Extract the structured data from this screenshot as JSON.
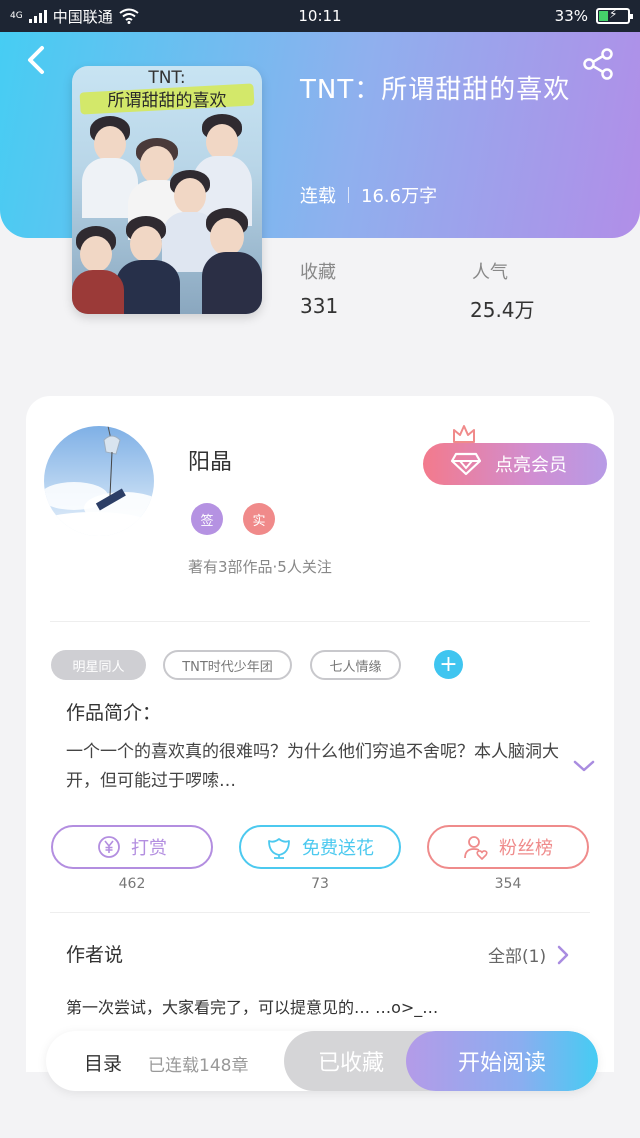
{
  "status_bar": {
    "network": "4G",
    "carrier": "中国联通",
    "time": "10:11",
    "battery": "33%",
    "battery_level": 0.33
  },
  "book": {
    "cover_title_top": "TNT:",
    "cover_title_bottom": "所谓甜甜的喜欢",
    "title": "TNT：所谓甜甜的喜欢",
    "status": "连载",
    "word_count": "16.6万字",
    "favorites_label": "收藏",
    "favorites_value": "331",
    "popularity_label": "人气",
    "popularity_value": "25.4万"
  },
  "author": {
    "name": "阳晶",
    "badge_sign": "签",
    "badge_real": "实",
    "stats": "著有3部作品·5人关注",
    "vip_button": "点亮会员"
  },
  "tags": [
    "明星同人",
    "TNT时代少年团",
    "七人情缘"
  ],
  "tag_add": "+",
  "intro": {
    "heading": "作品简介：",
    "text": "一个一个的喜欢真的很难吗？为什么他们穷追不舍呢？本人脑洞大开，但可能过于啰嗦…"
  },
  "actions": [
    {
      "label": "打赏",
      "count": "462",
      "color": "#b38ee0"
    },
    {
      "label": "免费送花",
      "count": "73",
      "color": "#4cc9ef"
    },
    {
      "label": "粉丝榜",
      "count": "354",
      "color": "#ef8b8b"
    }
  ],
  "author_says": {
    "heading": "作者说",
    "all_link": "全部(1)",
    "text": "第一次尝试，大家看完了，可以提意见的… …o>_…"
  },
  "bottom_bar": {
    "toc": "目录",
    "chapters": "已连载148章",
    "favorited": "已收藏",
    "start_reading": "开始阅读"
  },
  "colors": {
    "hero_start": "#46cdf3",
    "hero_end": "#b18ee8",
    "accent_blue": "#3fc5f0",
    "accent_purple": "#b38ee0",
    "accent_pink": "#ef8b8b"
  },
  "icons": {
    "back": "back-arrow-icon",
    "share": "share-icon",
    "vip": "diamond-icon",
    "crown": "crown-icon",
    "expand": "chevron-down-icon",
    "reward": "yen-icon",
    "flower": "flower-icon",
    "fans": "user-heart-icon",
    "more": "chevron-right-icon"
  }
}
